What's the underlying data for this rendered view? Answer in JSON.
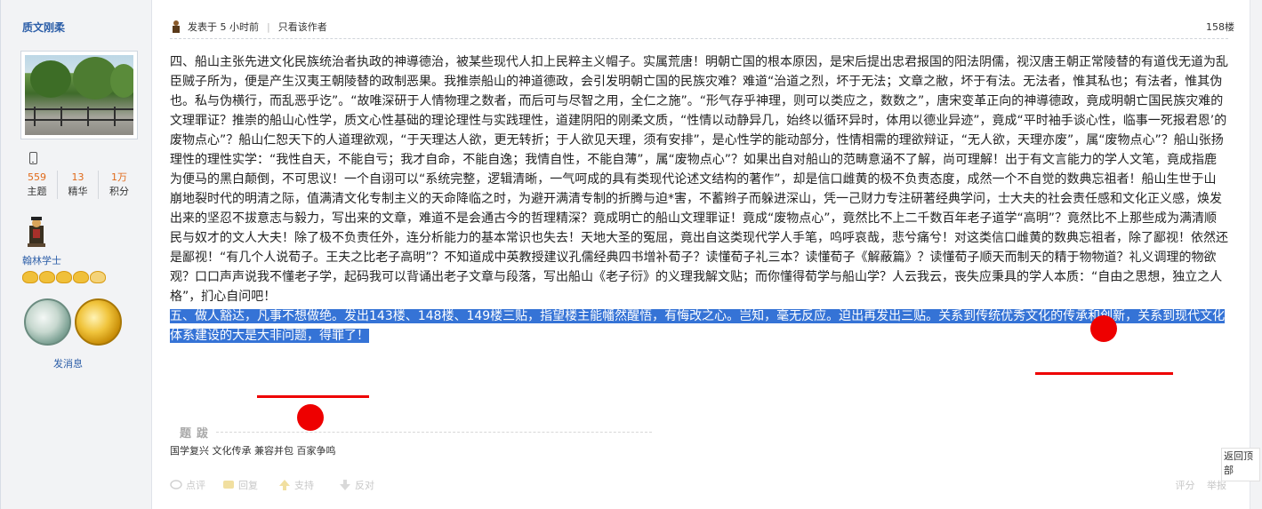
{
  "sidebar": {
    "username": "质文刚柔",
    "stats": [
      {
        "num": "559",
        "label": "主题"
      },
      {
        "num": "13",
        "label": "精华"
      },
      {
        "num": "1万",
        "label": "积分"
      }
    ],
    "rank_title": "翰林学士",
    "send_message": "发消息"
  },
  "post": {
    "time": "发表于 5 小时前",
    "only_author": "只看该作者",
    "floor": "158楼",
    "paragraph4": "四、船山主张先进文化民族统治者执政的神導德治，被某些现代人扣上民粹主义帽子。实属荒唐！明朝亡国的根本原因，是宋后提出忠君报国的阳法阴儒，视汉唐王朝正常陵替的有道伐无道为乱臣贼子所为，便是产生汉夷王朝陵替的政制恶果。我推崇船山的神道德政，会引发明朝亡国的民族灾难？难道“治道之烈，坏于无法；文章之敝，坏于有法。无法者，惟其私也；有法者，惟其伪也。私与伪横行，而乱恶乎讫”。“故唯深研于人情物理之数者，而后可与尽智之用，全仁之施”。“形气存乎神理，则可以类应之，数数之”，唐宋变革正向的神導德政，竟成明朝亡国民族灾难的文理罪证？推崇的船山心性学，质文心性基础的理论理性与实践理性，道建阴阳的刚柔文质，“性情以动静异几，始终以循环异时，体用以德业异迹”，竟成“平时袖手谈心性，临事一死报君恩’的废物点心”？船山仁恕天下的人道理欲观，“于天理达人欲，更无转折；于人欲见天理，须有安排”，是心性学的能动部分，性情相需的理欲辩证，“无人欲，天理亦废”，属“废物点心”？船山张扬理性的理性实学：“我性自天，不能自亏；我才自命，不能自逸；我情自性，不能自薄”，属“废物点心”？如果出自对船山的范畴意涵不了解，尚可理解！出于有文言能力的学人文笔，竟成指鹿为便马的黑白颠倒，不可思议！一个自诩可以“系统完整，逻辑清晰，一气呵成的具有类现代论述文结构的著作”，却是信口雌黄的极不负责态度，成然一个不自觉的数典忘祖者！船山生世于山崩地裂时代的明清之际，值满清文化专制主义的天命降临之时，为避开满清专制的折腾与迫*害，不蓄辫子而躲进深山，凭一己财力专注研著经典学问，士大夫的社会责任感和文化正义感，焕发出来的坚忍不拔意志与毅力，写出来的文章，难道不是会通古今的哲理精深？竟成明亡的船山文理罪证！竟成“废物点心”，竟然比不上二千数百年老子道学“高明”？竟然比不上那些成为满清顺民与奴才的文人大夫！除了极不负责任外，连分析能力的基本常识也失去！天地大圣的冤屈，竟出自这类现代学人手笔，呜呼哀哉，悲兮痛兮！对这类信口雌黄的数典忘祖者，除了鄙视！依然还是鄙视！“有几个人说荀子。王夫之比老子高明”？不知道成中英教授建议孔儒经典四书增补荀子？读懂荀子礼三本？读懂荀子《解蔽篇》？读懂荀子顺天而制天的精于物物道？礼义调理的物欲观？口口声声说我不懂老子学，起码我可以背诵出老子文章与段落，写出船山《老子衍》的义理我解文贴；而你懂得荀学与船山学？人云我云，丧失应秉具的学人本质：“自由之思想，独立之人格”，扪心自问吧！",
    "paragraph5": "五、做人豁达，凡事不想做绝。发出143楼、148楼、149楼三贴，指望楼主能幡然醒悟，有悔改之心。岂知，毫无反应。迫出再发出三贴。关系到传统优秀文化的传承和创新，关系到现代文化体系建设的大是大非问题，得罪了！",
    "signature_title": "题跋",
    "signature_text": "国学复兴 文化传承 兼容并包 百家争鸣"
  },
  "actions": {
    "comment": "点评",
    "reply": "回复",
    "support": "支持",
    "oppose": "反对",
    "rate": "评分",
    "report": "举报"
  },
  "back_to_top": "返回顶部",
  "colors": {
    "link_blue": "#2c5ea8",
    "stat_orange": "#e06a1a",
    "selection_blue": "#3573d6",
    "annotation_red": "#ee0000"
  }
}
